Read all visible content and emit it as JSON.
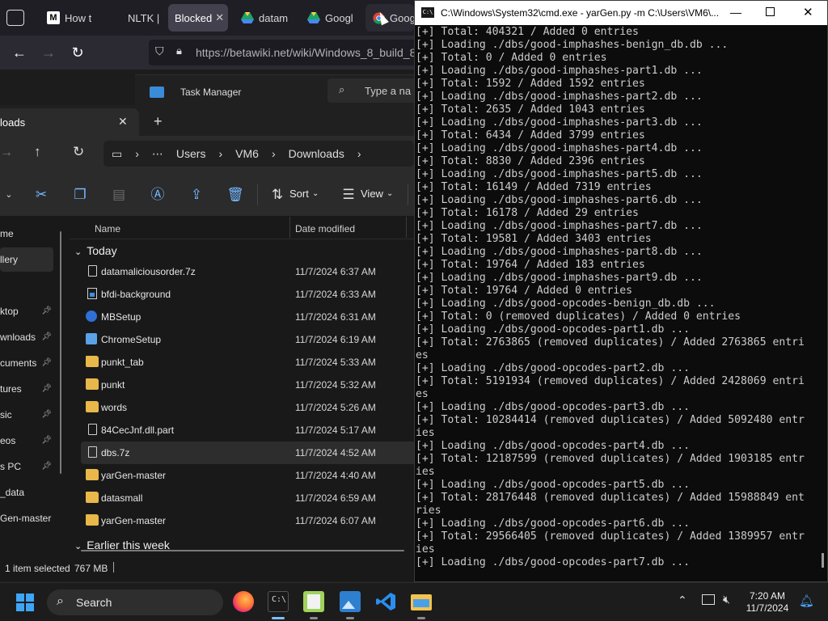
{
  "browser": {
    "tabs": [
      {
        "label": "How t",
        "favicon": "M"
      },
      {
        "label": "NLTK |",
        "favicon": ""
      },
      {
        "label": "Blocked",
        "favicon": "",
        "active": true
      },
      {
        "label": "datam",
        "favicon": "drive-icon"
      },
      {
        "label": "Googl",
        "favicon": "drive-icon"
      },
      {
        "label": "Googl",
        "favicon": "chrome-icon"
      }
    ],
    "url": "https://betawiki.net/wiki/Windows_8_build_8",
    "behind_window": {
      "title": "Task Manager",
      "search_placeholder": "Type a na"
    }
  },
  "explorer": {
    "tab_title": "loads",
    "breadcrumb": [
      "Users",
      "VM6",
      "Downloads"
    ],
    "toolbar": {
      "sort_label": "Sort",
      "view_label": "View"
    },
    "sidebar": [
      {
        "label": "me",
        "pinned": false
      },
      {
        "label": "llery",
        "pinned": false,
        "selected": true
      },
      {
        "label": "ktop",
        "pinned": true
      },
      {
        "label": "wnloads",
        "pinned": true
      },
      {
        "label": "cuments",
        "pinned": true
      },
      {
        "label": "tures",
        "pinned": true
      },
      {
        "label": "sic",
        "pinned": true
      },
      {
        "label": "eos",
        "pinned": true
      },
      {
        "label": "s PC",
        "pinned": true
      },
      {
        "label": "_data",
        "pinned": false
      },
      {
        "label": "Gen-master",
        "pinned": false
      }
    ],
    "columns": {
      "name": "Name",
      "date": "Date modified"
    },
    "group_today": "Today",
    "group_earlier": "Earlier this week",
    "files": [
      {
        "name": "datamaliciousorder.7z",
        "date": "11/7/2024 6:37 AM",
        "type": "file"
      },
      {
        "name": "bfdi-background",
        "date": "11/7/2024 6:33 AM",
        "type": "image"
      },
      {
        "name": "MBSetup",
        "date": "11/7/2024 6:31 AM",
        "type": "exe"
      },
      {
        "name": "ChromeSetup",
        "date": "11/7/2024 6:19 AM",
        "type": "exe"
      },
      {
        "name": "punkt_tab",
        "date": "11/7/2024 5:33 AM",
        "type": "folder"
      },
      {
        "name": "punkt",
        "date": "11/7/2024 5:32 AM",
        "type": "folder"
      },
      {
        "name": "words",
        "date": "11/7/2024 5:26 AM",
        "type": "folder"
      },
      {
        "name": "84CecJnf.dll.part",
        "date": "11/7/2024 5:17 AM",
        "type": "file"
      },
      {
        "name": "dbs.7z",
        "date": "11/7/2024 4:52 AM",
        "type": "file",
        "selected": true
      },
      {
        "name": "yarGen-master",
        "date": "11/7/2024 4:40 AM",
        "type": "folder"
      },
      {
        "name": "datasmall",
        "date": "11/7/2024 6:59 AM",
        "type": "folder"
      },
      {
        "name": "yarGen-master",
        "date": "11/7/2024 6:07 AM",
        "type": "folder"
      }
    ],
    "status": {
      "selected": "1 item selected",
      "size": "767 MB"
    }
  },
  "cmd": {
    "title": "C:\\Windows\\System32\\cmd.exe - yarGen.py  -m C:\\Users\\VM6\\...",
    "lines": [
      "[+] Total: 404321 / Added 0 entries",
      "[+] Loading ./dbs/good-imphashes-benign_db.db ...",
      "[+] Total: 0 / Added 0 entries",
      "[+] Loading ./dbs/good-imphashes-part1.db ...",
      "[+] Total: 1592 / Added 1592 entries",
      "[+] Loading ./dbs/good-imphashes-part2.db ...",
      "[+] Total: 2635 / Added 1043 entries",
      "[+] Loading ./dbs/good-imphashes-part3.db ...",
      "[+] Total: 6434 / Added 3799 entries",
      "[+] Loading ./dbs/good-imphashes-part4.db ...",
      "[+] Total: 8830 / Added 2396 entries",
      "[+] Loading ./dbs/good-imphashes-part5.db ...",
      "[+] Total: 16149 / Added 7319 entries",
      "[+] Loading ./dbs/good-imphashes-part6.db ...",
      "[+] Total: 16178 / Added 29 entries",
      "[+] Loading ./dbs/good-imphashes-part7.db ...",
      "[+] Total: 19581 / Added 3403 entries",
      "[+] Loading ./dbs/good-imphashes-part8.db ...",
      "[+] Total: 19764 / Added 183 entries",
      "[+] Loading ./dbs/good-imphashes-part9.db ...",
      "[+] Total: 19764 / Added 0 entries",
      "[+] Loading ./dbs/good-opcodes-benign_db.db ...",
      "[+] Total: 0 (removed duplicates) / Added 0 entries",
      "[+] Loading ./dbs/good-opcodes-part1.db ...",
      "[+] Total: 2763865 (removed duplicates) / Added 2763865 entri",
      "es",
      "[+] Loading ./dbs/good-opcodes-part2.db ...",
      "[+] Total: 5191934 (removed duplicates) / Added 2428069 entri",
      "es",
      "[+] Loading ./dbs/good-opcodes-part3.db ...",
      "[+] Total: 10284414 (removed duplicates) / Added 5092480 entr",
      "ies",
      "[+] Loading ./dbs/good-opcodes-part4.db ...",
      "[+] Total: 12187599 (removed duplicates) / Added 1903185 entr",
      "ies",
      "[+] Loading ./dbs/good-opcodes-part5.db ...",
      "[+] Total: 28176448 (removed duplicates) / Added 15988849 ent",
      "ries",
      "[+] Loading ./dbs/good-opcodes-part6.db ...",
      "[+] Total: 29566405 (removed duplicates) / Added 1389957 entr",
      "ies",
      "[+] Loading ./dbs/good-opcodes-part7.db ..."
    ]
  },
  "taskbar": {
    "search_label": "Search",
    "time": "7:20 AM",
    "date": "11/7/2024"
  }
}
